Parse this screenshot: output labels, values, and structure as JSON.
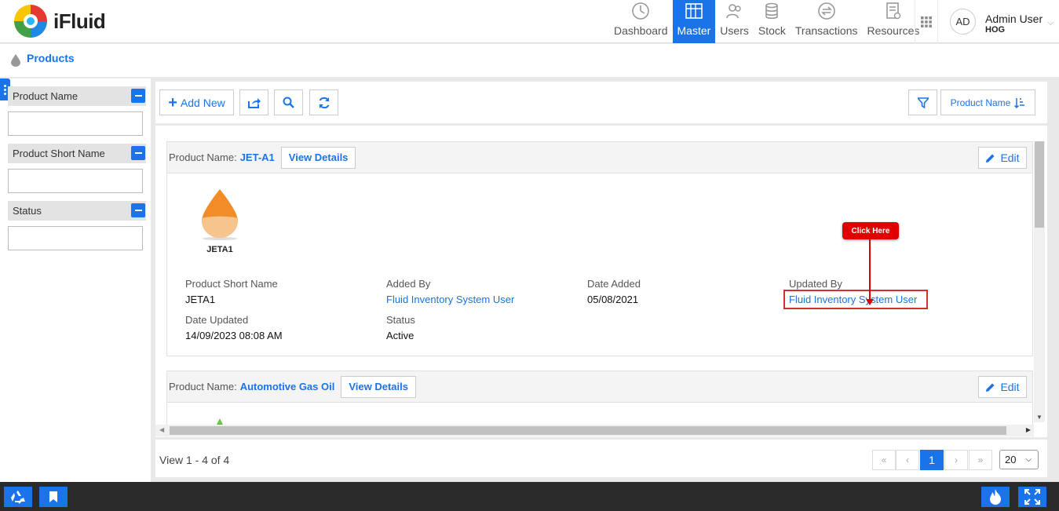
{
  "app": {
    "name": "iFluid"
  },
  "nav": [
    {
      "label": "Dashboard",
      "icon": "dashboard-icon"
    },
    {
      "label": "Master",
      "icon": "master-icon",
      "active": true
    },
    {
      "label": "Users",
      "icon": "users-icon"
    },
    {
      "label": "Stock",
      "icon": "stock-icon"
    },
    {
      "label": "Transactions",
      "icon": "transactions-icon"
    },
    {
      "label": "Resources",
      "icon": "resources-icon"
    }
  ],
  "user": {
    "initials": "AD",
    "name": "Admin User",
    "role": "HOG"
  },
  "breadcrumb": {
    "title": "Products"
  },
  "filters": [
    {
      "label": "Product Name",
      "value": ""
    },
    {
      "label": "Product Short Name",
      "value": ""
    },
    {
      "label": "Status",
      "value": ""
    }
  ],
  "toolbar": {
    "add_new": "Add New",
    "sort_label": "Product Name"
  },
  "products": [
    {
      "name_label": "Product Name:",
      "name": "JET-A1",
      "view_details": "View Details",
      "edit": "Edit",
      "drop_caption": "JETA1",
      "drop_color": "#f28c28",
      "fields": {
        "short_name_label": "Product Short Name",
        "short_name": "JETA1",
        "added_by_label": "Added By",
        "added_by": "Fluid Inventory System User",
        "date_added_label": "Date Added",
        "date_added": "05/08/2021",
        "updated_by_label": "Updated By",
        "updated_by": "Fluid Inventory System User",
        "date_updated_label": "Date Updated",
        "date_updated": "14/09/2023 08:08 AM",
        "status_label": "Status",
        "status": "Active"
      }
    },
    {
      "name_label": "Product Name:",
      "name": "Automotive Gas Oil",
      "view_details": "View Details",
      "edit": "Edit",
      "drop_color": "#6cc04a"
    }
  ],
  "callout": {
    "text": "Click Here"
  },
  "pager": {
    "view_text": "View 1 - 4 of 4",
    "current_page": "1",
    "page_size": "20"
  },
  "colors": {
    "accent": "#1a73e8",
    "callout": "#e00000"
  }
}
